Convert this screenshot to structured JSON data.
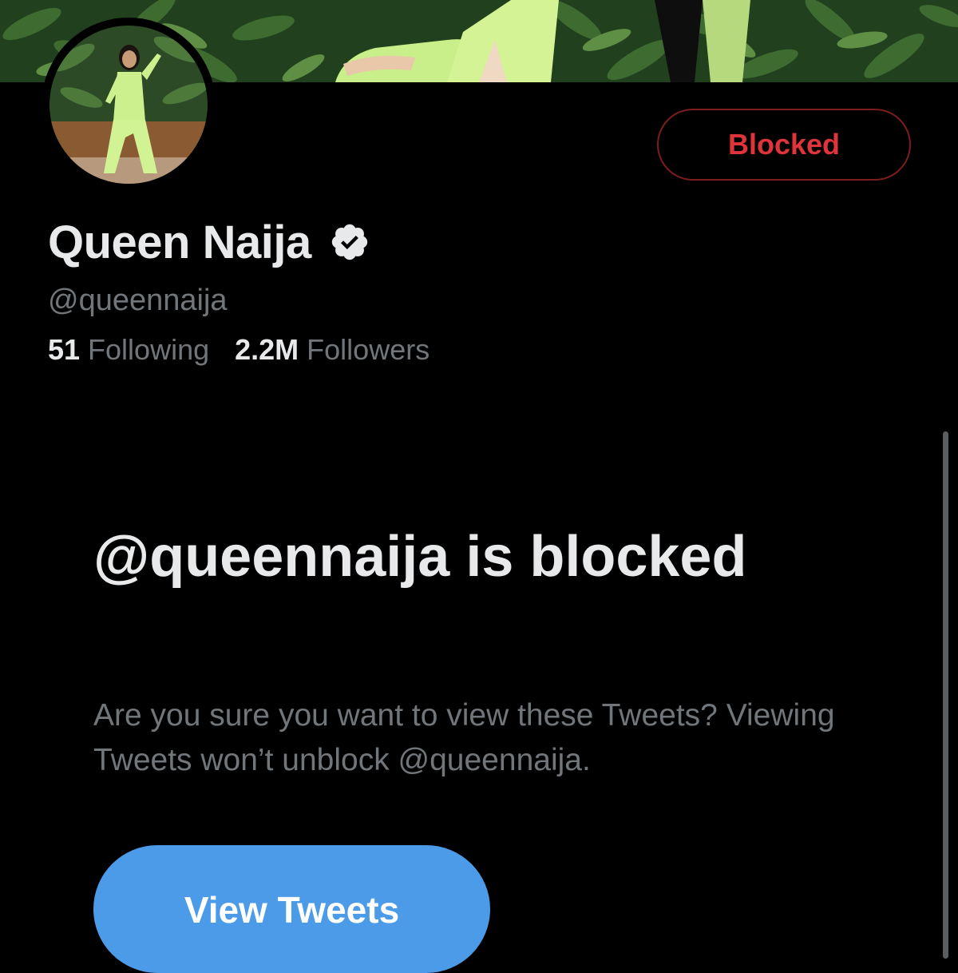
{
  "header": {
    "blocked_label": "Blocked"
  },
  "profile": {
    "display_name": "Queen Naija",
    "handle": "@queennaija",
    "following_count": "51",
    "following_label": "Following",
    "followers_count": "2.2M",
    "followers_label": "Followers",
    "verified": true
  },
  "blocked_notice": {
    "title": "@queennaija is blocked",
    "subtitle": "Are you sure you want to view these Tweets? Viewing Tweets won’t unblock @queennaija.",
    "button_label": "View Tweets"
  },
  "colors": {
    "background": "#000000",
    "primary_text": "#e7e9ea",
    "secondary_text": "#71767b",
    "blocked_red": "#e0343b",
    "accent_blue": "#4c9be8"
  },
  "icons": {
    "verified": "verified-badge-icon"
  }
}
